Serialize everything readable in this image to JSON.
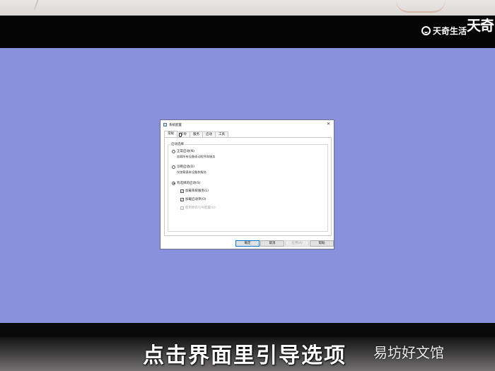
{
  "dialog": {
    "title": "系统配置",
    "close_glyph": "✕",
    "tabs": [
      {
        "label": "常规",
        "active": true
      },
      {
        "label": "引导",
        "active": false
      },
      {
        "label": "服务",
        "active": false
      },
      {
        "label": "启动",
        "active": false
      },
      {
        "label": "工具",
        "active": false
      }
    ],
    "startup_group": {
      "label": "启动选择",
      "normal": {
        "label": "正常启动(N)",
        "desc": "加载所有设备驱动程序和服务",
        "selected": false
      },
      "diagnostic": {
        "label": "诊断启动(D)",
        "desc": "仅加载基本设备和服务",
        "selected": false
      },
      "selective": {
        "label": "有选择的启动(S)",
        "selected": true,
        "options": [
          {
            "label": "加载系统服务(L)",
            "checked": true,
            "enabled": true
          },
          {
            "label": "加载启动项(O)",
            "checked": true,
            "enabled": true
          },
          {
            "label": "使用原有引导配置(U)",
            "checked": true,
            "enabled": false
          }
        ]
      }
    },
    "buttons": {
      "ok": "确定",
      "cancel": "取消",
      "apply": "应用(A)",
      "help": "帮助"
    }
  },
  "overlay": {
    "logo_text": "天奇生活",
    "logo_cut_text": "天奇",
    "subtitle": "点击界面里引导选项",
    "watermark": "易坊好文馆"
  },
  "colors": {
    "desktop": "#8a91dc",
    "bezel": "#0a0a0a",
    "default_button_border": "#0078d7"
  },
  "icons": {
    "check": "✓"
  }
}
